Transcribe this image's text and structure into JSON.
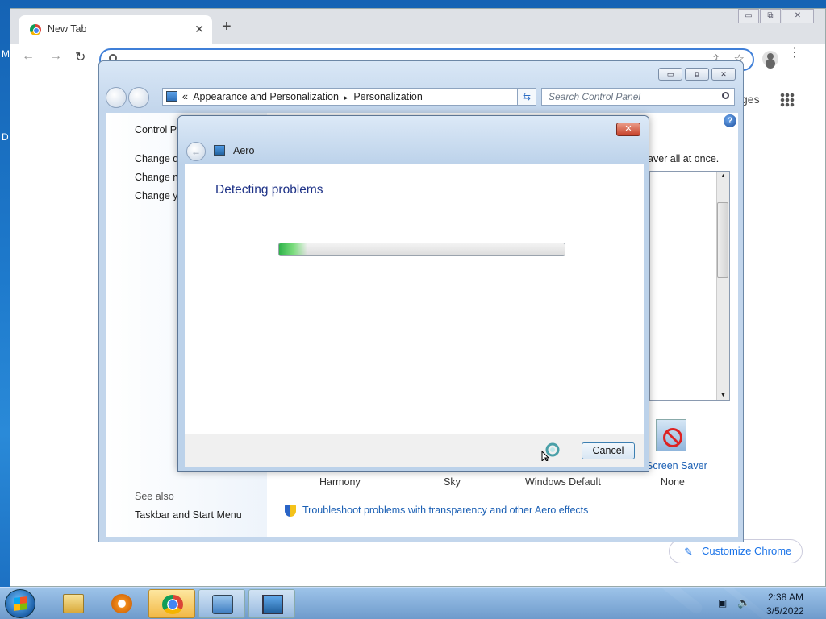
{
  "desktop": {
    "edge_letters": [
      "M",
      "D"
    ]
  },
  "chrome": {
    "tab_title": "New Tab",
    "close_tab": "✕",
    "new_tab": "+",
    "window_buttons": [
      "▭",
      "⧉",
      "✕"
    ],
    "nav": {
      "back": "←",
      "forward": "→",
      "reload": "↻"
    },
    "toolbar_icons": [
      "share-icon",
      "star-icon",
      "account-icon",
      "menu-icon"
    ],
    "partial_text_right": "ges",
    "customize_label": "Customize Chrome"
  },
  "control_panel": {
    "window_buttons": [
      "▭",
      "⧉",
      "✕"
    ],
    "address_prefix": "«",
    "breadcrumb": [
      "Appearance and Personalization",
      "Personalization"
    ],
    "breadcrumb_separator": "▸",
    "search_placeholder": "Search Control Panel",
    "left_links": [
      "Control Pan",
      "Change des",
      "Change mo",
      "Change you"
    ],
    "see_also_heading": "See also",
    "see_also_link": "Taskbar and Start Menu",
    "description_tail": "aver all at once.",
    "themes": [
      "Harmony",
      "Sky",
      "Windows Default"
    ],
    "screen_saver": {
      "title": "Screen Saver",
      "value": "None"
    },
    "troubleshoot_link": "Troubleshoot problems with transparency and other Aero effects",
    "help_label": "?"
  },
  "dialog": {
    "title": "Aero",
    "close_label": "✕",
    "heading": "Detecting problems",
    "progress_percent": 10,
    "cancel_label": "Cancel"
  },
  "taskbar": {
    "apps": [
      "windows-explorer",
      "media-player",
      "google-chrome",
      "control-panel",
      "personalization"
    ],
    "time": "2:38 AM",
    "date": "3/5/2022"
  },
  "colors": {
    "accent": "#1a5fb4",
    "progress_green": "#2fb34a",
    "chrome_blue": "#1a73e8"
  }
}
